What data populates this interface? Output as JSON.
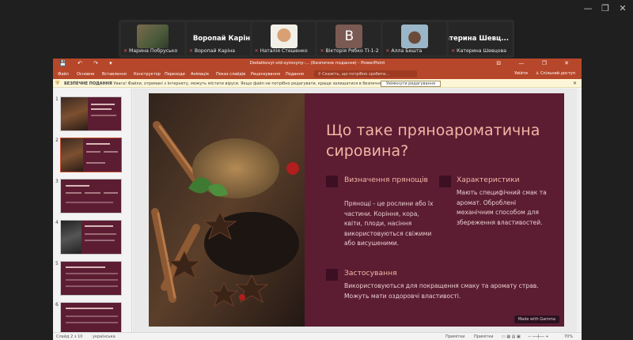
{
  "participants": [
    {
      "display": "",
      "name": "Марина Побрусько"
    },
    {
      "display": "Воропай Каріна",
      "name": "Воропай Каріна"
    },
    {
      "display": "",
      "name": "Наталія Стешенко"
    },
    {
      "display": "В",
      "name": "Вікторія Рябко ТІ-1-2"
    },
    {
      "display": "",
      "name": "Алла Бешта"
    },
    {
      "display": "Катерина  Шевц...",
      "name": "Катерина Шевцова"
    }
  ],
  "window_controls": {
    "minimize": "—",
    "restore": "❐",
    "close": "✕"
  },
  "ppt": {
    "title": "Dodatkovyi-vid-syrovyny-…  (Безпечне подання) - PowerPoint",
    "quick_access": "💾 ↶ ↷ ▾",
    "tabs": [
      "Файл",
      "Основне",
      "Вставлення",
      "Конструктор",
      "Переходи",
      "Анімація",
      "Показ слайдів",
      "Рецензування",
      "Подання"
    ],
    "search_placeholder": "Скажіть, що потрібно зробити...",
    "ribbon_right": [
      "Увійти",
      "Спільний доступ"
    ],
    "warning": {
      "label": "БЕЗПЕЧНЕ ПОДАННЯ",
      "text": "Увага! Файли, отримані з Інтернету, можуть містити віруси. Якщо файл не потрібно редагувати, краще залишатися в безпечному поданні.",
      "button": "Увімкнути редагування"
    },
    "thumbnail_numbers": [
      "1",
      "2",
      "3",
      "4",
      "5",
      "6"
    ],
    "status": {
      "slide": "Слайд 2 з 10",
      "language": "українська",
      "notes": "Примітки",
      "comments": "Примітки",
      "zoom": "70%"
    }
  },
  "slide": {
    "title": "Що таке пряноароматична сировина?",
    "sections": [
      {
        "heading": "Визначення прянощів",
        "body": "Прянощі - це рослини або їх частини. Коріння, кора, квіти, плоди, насіння використовуються свіжими або висушеними."
      },
      {
        "heading": "Характеристики",
        "body": "Мають специфічний смак та аромат. Оброблені механічним способом для збереження властивостей."
      },
      {
        "heading": "Застосування",
        "body": "Використовуються для покращення смаку та аромату страв. Можуть мати оздоровчі властивості."
      }
    ],
    "watermark": "Made with Gamma"
  },
  "colors": {
    "slide_bg": "#5c1d33",
    "accent": "#f2b6a4",
    "ribbon": "#b7472a"
  }
}
